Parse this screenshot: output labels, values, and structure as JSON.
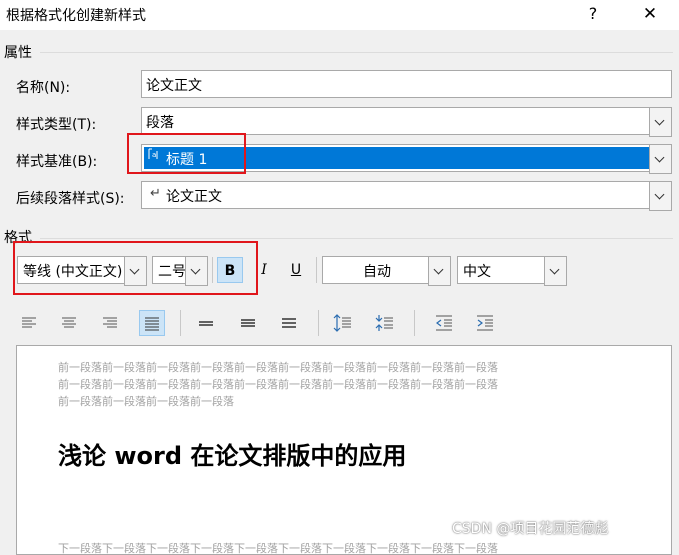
{
  "dialog": {
    "title": "根据格式化创建新样式",
    "help_label": "?",
    "close_label": "✕"
  },
  "properties": {
    "section_label": "属性",
    "name_label": "名称(N):",
    "name_value": "论文正文",
    "style_type_label": "样式类型(T):",
    "style_type_value": "段落",
    "based_on_label": "样式基准(B):",
    "based_on_value": "标题 1",
    "following_label": "后续段落样式(S):",
    "following_value": "论文正文"
  },
  "format": {
    "section_label": "格式",
    "font_value": "等线 (中文正文)",
    "size_value": "二号",
    "bold_label": "B",
    "italic_label": "I",
    "underline_label": "U",
    "color_value": "自动",
    "language_value": "中文"
  },
  "preview": {
    "prev_lines": [
      "前一段落前一段落前一段落前一段落前一段落前一段落前一段落前一段落前一段落前一段落",
      "前一段落前一段落前一段落前一段落前一段落前一段落前一段落前一段落前一段落前一段落",
      "前一段落前一段落前一段落前一段落"
    ],
    "heading_sample": "浅论 word 在论文排版中的应用",
    "next_line": "下一段落下一段落下一段落下一段落下一段落下一段落下一段落下一段落下一段落下一段落"
  },
  "watermark": "CSDN @项目花园范德彪",
  "colors": {
    "selection": "#0078d7",
    "highlight_box": "#e0161b",
    "active_button": "#cce4f7"
  }
}
